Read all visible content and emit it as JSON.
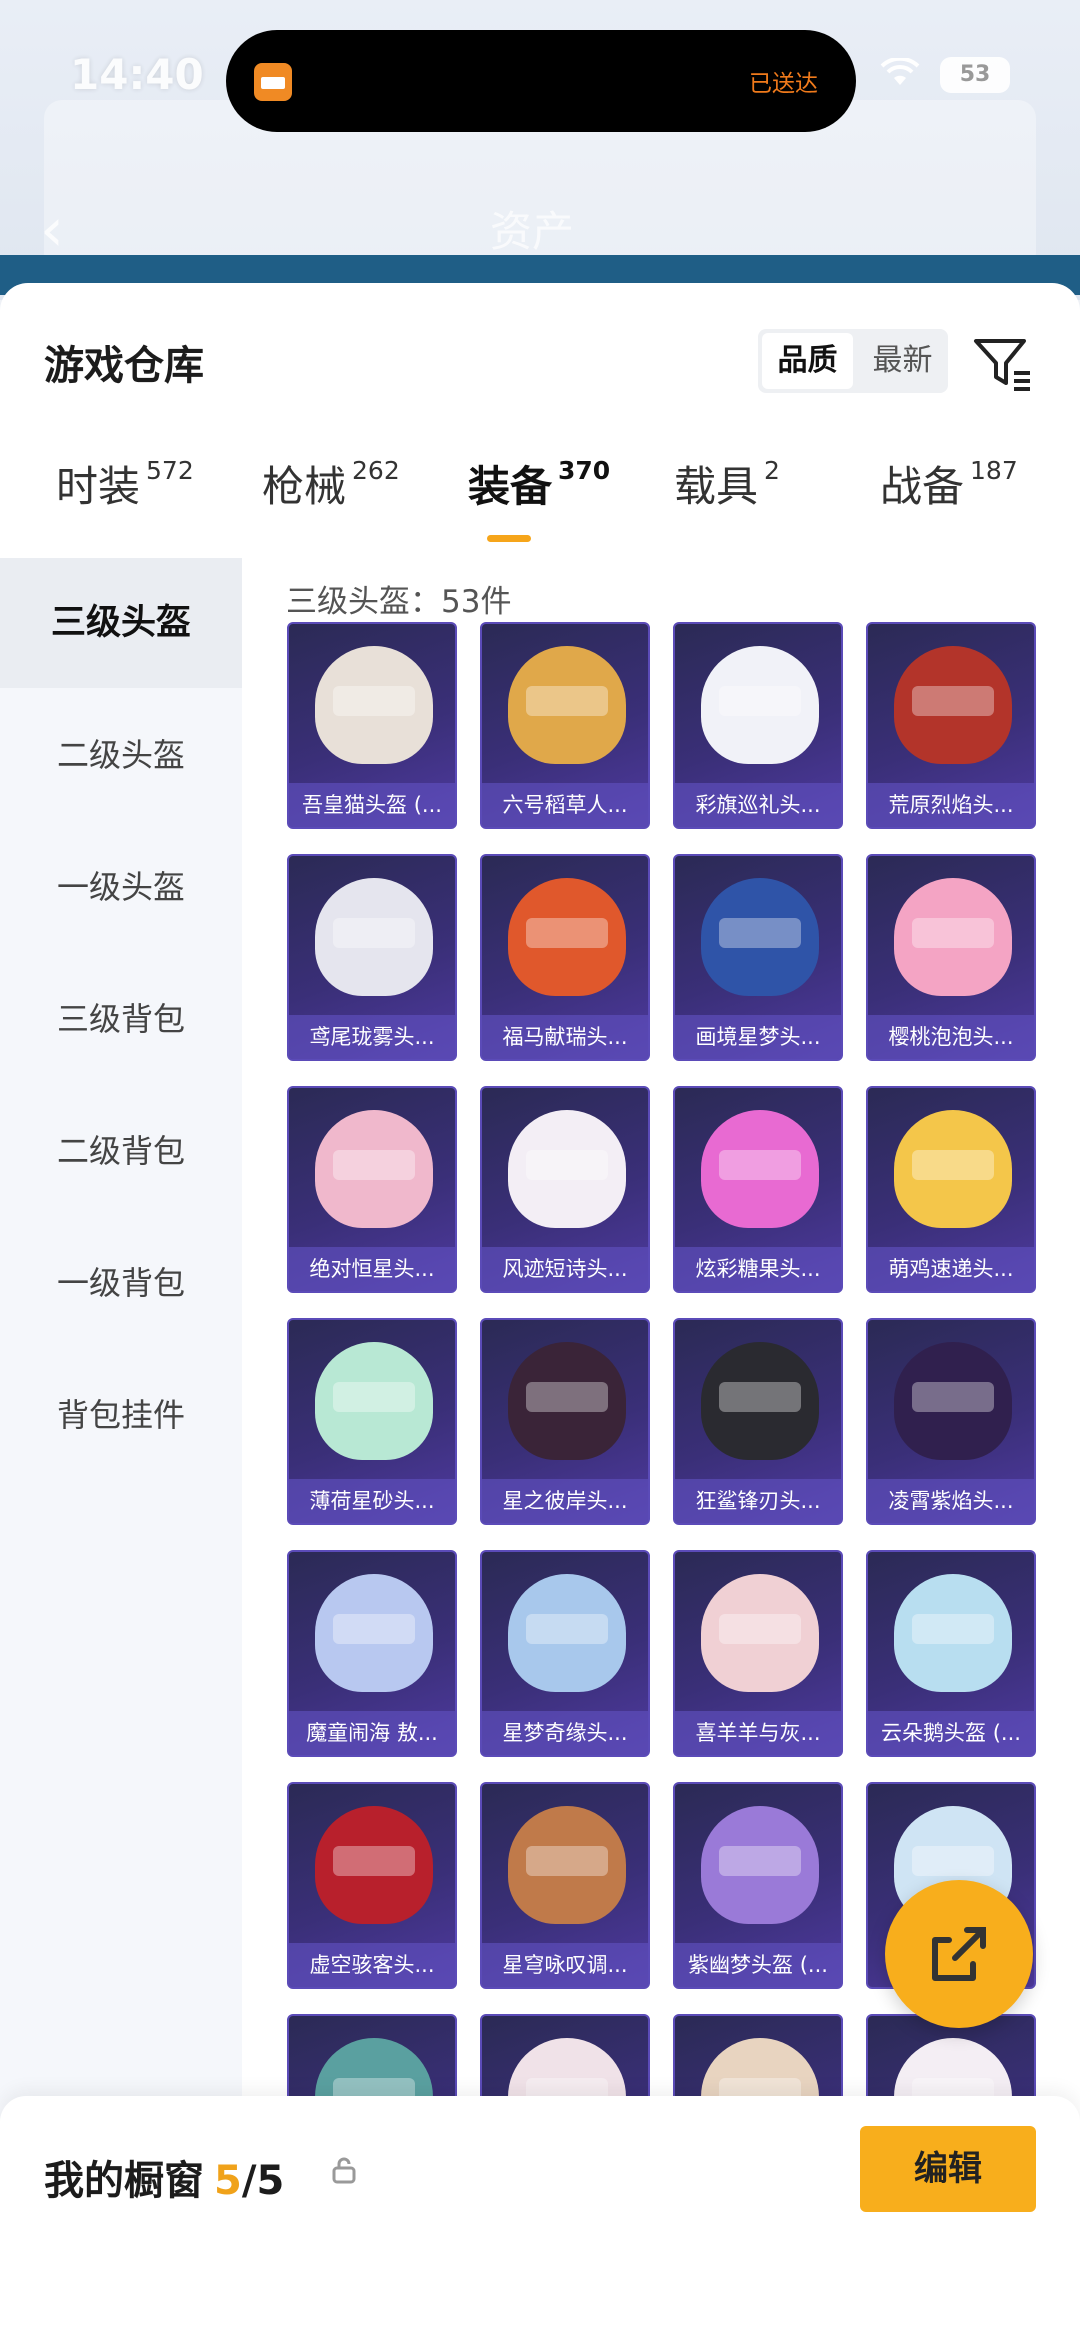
{
  "status": {
    "time": "14:40",
    "delivered": "已送达",
    "battery": "53"
  },
  "header": {
    "title": "资产"
  },
  "sheet": {
    "title": "游戏仓库",
    "sort_options": [
      "品质",
      "最新"
    ],
    "active_sort": "品质"
  },
  "tabs": [
    {
      "label": "时装",
      "count": "572"
    },
    {
      "label": "枪械",
      "count": "262"
    },
    {
      "label": "装备",
      "count": "370"
    },
    {
      "label": "载具",
      "count": "2"
    },
    {
      "label": "战备",
      "count": "187"
    }
  ],
  "sidebar": {
    "items": [
      "三级头盔",
      "二级头盔",
      "一级头盔",
      "三级背包",
      "二级背包",
      "一级背包",
      "背包挂件"
    ]
  },
  "content": {
    "count_line": "三级头盔：53件",
    "items": [
      {
        "name": "吾皇猫头盔 (...",
        "color": "#e8e0d8"
      },
      {
        "name": "六号稻草人...",
        "color": "#e0a84a"
      },
      {
        "name": "彩旗巡礼头...",
        "color": "#f1f2f8"
      },
      {
        "name": "荒原烈焰头...",
        "color": "#b3342a"
      },
      {
        "name": "鸢尾珑雾头...",
        "color": "#e5e5ee"
      },
      {
        "name": "福马献瑞头...",
        "color": "#e0582c"
      },
      {
        "name": "画境星梦头...",
        "color": "#2f54a8"
      },
      {
        "name": "樱桃泡泡头...",
        "color": "#f4a4c4"
      },
      {
        "name": "绝对恒星头...",
        "color": "#f0b8cc"
      },
      {
        "name": "风迹短诗头...",
        "color": "#f3eef5"
      },
      {
        "name": "炫彩糖果头...",
        "color": "#e86ad2"
      },
      {
        "name": "萌鸡速递头...",
        "color": "#f4c64a"
      },
      {
        "name": "薄荷星砂头...",
        "color": "#b8e8d4"
      },
      {
        "name": "星之彼岸头...",
        "color": "#3a2438"
      },
      {
        "name": "狂鲨锋刃头...",
        "color": "#2a2a30"
      },
      {
        "name": "凌霄紫焰头...",
        "color": "#30204e"
      },
      {
        "name": "魔童闹海 敖...",
        "color": "#b8c8f0"
      },
      {
        "name": "星梦奇缘头...",
        "color": "#a8c8ec"
      },
      {
        "name": "喜羊羊与灰...",
        "color": "#f0d0d4"
      },
      {
        "name": "云朵鹅头盔 (...",
        "color": "#b8def0"
      },
      {
        "name": "虚空骇客头...",
        "color": "#b8202c"
      },
      {
        "name": "星穹咏叹调...",
        "color": "#c07a4a"
      },
      {
        "name": "紫幽梦头盔 (...",
        "color": "#9a7ad8"
      },
      {
        "name": "",
        "color": "#cfe4f4"
      },
      {
        "name": "",
        "color": "#5aa0a0"
      },
      {
        "name": "",
        "color": "#f0e2e8"
      },
      {
        "name": "",
        "color": "#e8d4c0"
      },
      {
        "name": "",
        "color": "#f4eef4"
      }
    ]
  },
  "bottom": {
    "label": "我的橱窗",
    "current": "5",
    "total": "/5",
    "edit_label": "编辑"
  },
  "colors": {
    "accent": "#f8ae1c",
    "card_bg": "#3a2f78"
  },
  "icons": [
    "back-icon",
    "wifi-icon",
    "battery-icon",
    "filter-icon",
    "lock-icon",
    "share-icon"
  ]
}
